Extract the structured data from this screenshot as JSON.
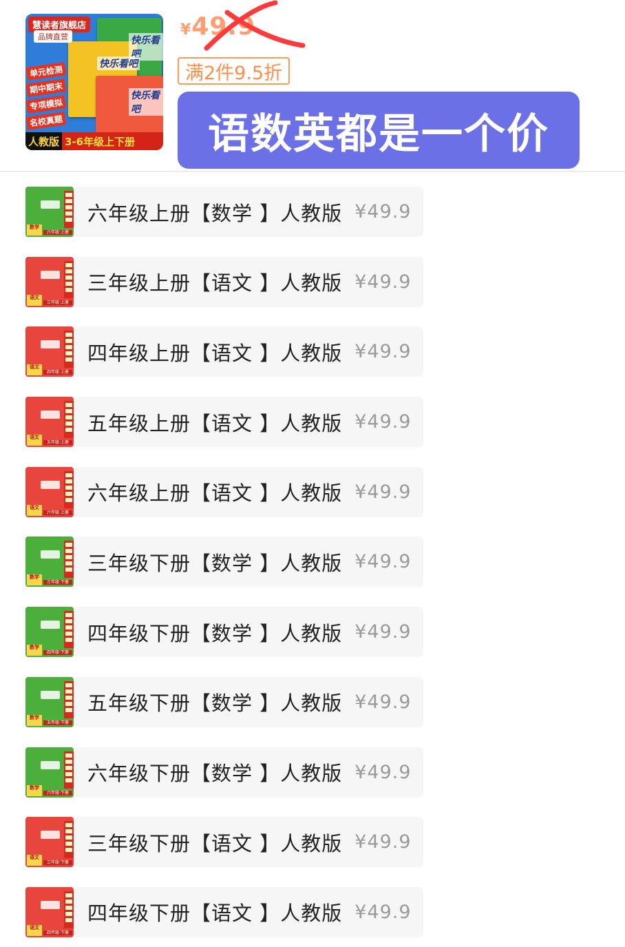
{
  "colors": {
    "accent_orange": "#ff5000",
    "banner_purple": "#6c70e6",
    "math_cover": "#4caf3c",
    "chinese_cover": "#e8453c"
  },
  "header": {
    "thumb": {
      "store_name": "慧读者旗舰店",
      "brand_direct": "品牌直营",
      "book_title": "快乐看吧",
      "tags": [
        "单元检测",
        "期中期末",
        "专项模拟",
        "名校真题"
      ],
      "edition": "人教版",
      "grades": "3-6年级上下册"
    },
    "price_old": "49.9",
    "price_symbol": "¥",
    "discount_tag": "满2件9.5折",
    "banner_text": "语数英都是一个价"
  },
  "skus": [
    {
      "label": "六年级上册【数学 】人教版",
      "price": "¥49.9",
      "subject": "数学",
      "grade_tag": "六年级·上册",
      "icon": "math-book-cover-icon"
    },
    {
      "label": "三年级上册【语文 】人教版",
      "price": "¥49.9",
      "subject": "语文",
      "grade_tag": "三年级·上册",
      "icon": "chinese-book-cover-icon"
    },
    {
      "label": "四年级上册【语文 】人教版",
      "price": "¥49.9",
      "subject": "语文",
      "grade_tag": "四年级·上册",
      "icon": "chinese-book-cover-icon"
    },
    {
      "label": "五年级上册【语文 】人教版",
      "price": "¥49.9",
      "subject": "语文",
      "grade_tag": "五年级·上册",
      "icon": "chinese-book-cover-icon"
    },
    {
      "label": "六年级上册【语文 】人教版",
      "price": "¥49.9",
      "subject": "语文",
      "grade_tag": "六年级·上册",
      "icon": "chinese-book-cover-icon"
    },
    {
      "label": "三年级下册【数学 】人教版",
      "price": "¥49.9",
      "subject": "数学",
      "grade_tag": "三年级·下册",
      "icon": "math-book-cover-icon"
    },
    {
      "label": "四年级下册【数学 】人教版",
      "price": "¥49.9",
      "subject": "数学",
      "grade_tag": "四年级·下册",
      "icon": "math-book-cover-icon"
    },
    {
      "label": "五年级下册【数学 】人教版",
      "price": "¥49.9",
      "subject": "数学",
      "grade_tag": "五年级·下册",
      "icon": "math-book-cover-icon"
    },
    {
      "label": "六年级下册【数学 】人教版",
      "price": "¥49.9",
      "subject": "数学",
      "grade_tag": "六年级·下册",
      "icon": "math-book-cover-icon"
    },
    {
      "label": "三年级下册【语文 】人教版",
      "price": "¥49.9",
      "subject": "语文",
      "grade_tag": "三年级·下册",
      "icon": "chinese-book-cover-icon"
    },
    {
      "label": "四年级下册【语文 】人教版",
      "price": "¥49.9",
      "subject": "语文",
      "grade_tag": "四年级·下册",
      "icon": "chinese-book-cover-icon"
    }
  ]
}
